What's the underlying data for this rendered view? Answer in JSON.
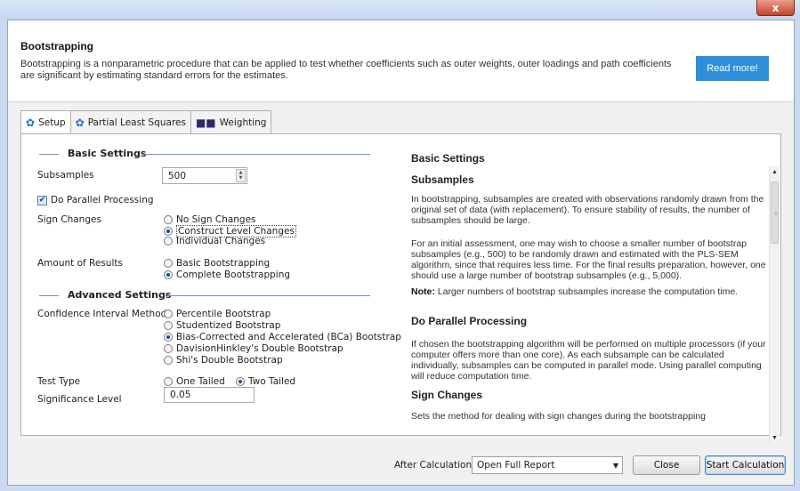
{
  "window": {
    "close_glyph": "x"
  },
  "header": {
    "title": "Bootstrapping",
    "description": "Bootstrapping is a nonparametric procedure that can be applied to test whether coefficients such as outer weights, outer loadings and path coefficients are significant by estimating standard errors for the estimates.",
    "read_more_label": "Read more!",
    "read_more_color": "#2f8fd8"
  },
  "tabs": [
    {
      "label": "Setup",
      "icon": "gear-icon",
      "active": true
    },
    {
      "label": "Partial Least Squares",
      "icon": "gear-icon",
      "active": false
    },
    {
      "label": "Weighting",
      "icon": "people-icon",
      "active": false
    }
  ],
  "setup": {
    "basic_title": "Basic Settings",
    "subsamples_label": "Subsamples",
    "subsamples_value": "500",
    "parallel_label": "Do Parallel Processing",
    "parallel_checked": true,
    "sign_changes_label": "Sign Changes",
    "sign_changes_options": [
      "No Sign Changes",
      "Construct Level Changes",
      "Individual Changes"
    ],
    "sign_changes_selected": "Construct Level Changes",
    "amount_label": "Amount of Results",
    "amount_options": [
      "Basic Bootstrapping",
      "Complete Bootstrapping"
    ],
    "amount_selected": "Complete Bootstrapping",
    "advanced_title": "Advanced Settings",
    "ci_label": "Confidence Interval Method",
    "ci_options": [
      "Percentile Bootstrap",
      "Studentized Bootstrap",
      "Bias-Corrected and Accelerated (BCa) Bootstrap",
      "DavisionHinkley's Double Bootstrap",
      "Shi's Double Bootstrap"
    ],
    "ci_selected": "Bias-Corrected and Accelerated (BCa) Bootstrap",
    "test_type_label": "Test Type",
    "test_type_options": [
      "One Tailed",
      "Two Tailed"
    ],
    "test_type_selected": "Two Tailed",
    "significance_label": "Significance Level",
    "significance_value": "0.05"
  },
  "help": {
    "h_basic": "Basic Settings",
    "h_subsamples": "Subsamples",
    "p_subsamples_1": "In bootstrapping, subsamples are created with observations randomly drawn from the original set of data (with replacement). To ensure stability of results, the number of subsamples should be large.",
    "p_subsamples_2": "For an initial assessment, one may wish to choose a smaller number of bootstrap subsamples (e.g., 500) to be randomly drawn and estimated with the PLS-SEM algorithm, since that requires less time. For the final results preparation, however, one should use a large number of bootstrap subsamples (e.g., 5,000).",
    "note_label": "Note:",
    "note_text": " Larger numbers of bootstrap subsamples increase the computation time.",
    "h_parallel": "Do Parallel Processing",
    "p_parallel": "If chosen the bootstrapping algorithm will be performed on multiple processors (if your computer offers more than one core). As each subsample can be calculated individually, subsamples can be computed in parallel mode. Using parallel computing will reduce computation time.",
    "h_sign": "Sign Changes",
    "p_sign": "Sets the method for dealing with sign changes during the bootstrapping"
  },
  "footer": {
    "after_label": "After Calculation:",
    "after_value": "Open Full Report",
    "close_label": "Close",
    "start_label": "Start Calculation"
  }
}
